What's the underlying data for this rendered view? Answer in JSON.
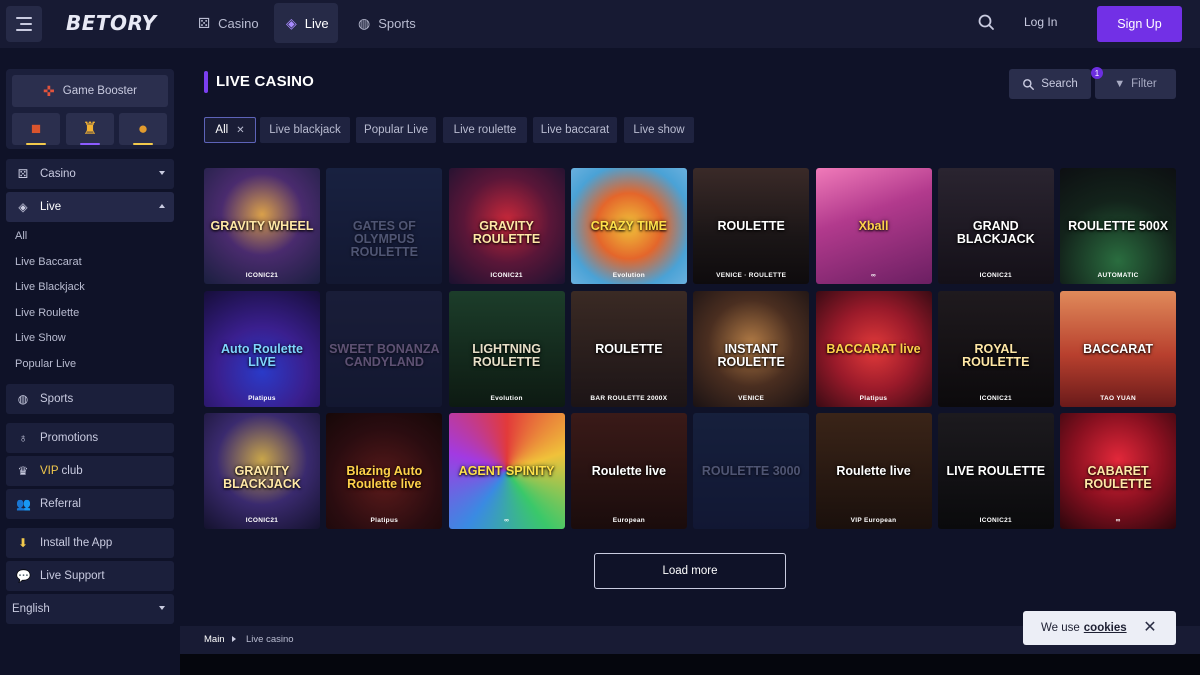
{
  "header": {
    "logo": "BETORY",
    "tabs": [
      {
        "label": "Casino",
        "icon": "casino-dice-icon"
      },
      {
        "label": "Live",
        "icon": "live-chip-icon"
      },
      {
        "label": "Sports",
        "icon": "sports-ball-icon"
      }
    ],
    "login_label": "Log In",
    "signup_label": "Sign Up",
    "accent_color": "#7230e6"
  },
  "sidebar": {
    "booster_label": "Game Booster",
    "booster_tiles": [
      {
        "icon": "dice-icon",
        "bar_color": "#f2c94c"
      },
      {
        "icon": "trophy-icon",
        "bar_color": "#8d5cff"
      },
      {
        "icon": "coin-icon",
        "bar_color": "#f2c94c"
      }
    ],
    "casino_label": "Casino",
    "live_label": "Live",
    "live_sub": [
      "All",
      "Live Baccarat",
      "Live Blackjack",
      "Live Roulette",
      "Live Show",
      "Popular Live"
    ],
    "sports_label": "Sports",
    "promotions_label": "Promotions",
    "vip_prefix": "VIP",
    "vip_suffix": "club",
    "referral_label": "Referral",
    "install_label": "Install the App",
    "support_label": "Live Support",
    "language": "English"
  },
  "main": {
    "title": "LIVE CASINO",
    "search_label": "Search",
    "filter_label": "Filter",
    "filter_count": "1",
    "chips": [
      "All",
      "Live blackjack",
      "Popular Live",
      "Live roulette",
      "Live baccarat",
      "Live show"
    ],
    "games": [
      {
        "name": "GRAVITY WHEEL",
        "provider": "ICONIC21"
      },
      {
        "name": "GATES OF OLYMPUS ROULETTE",
        "provider": ""
      },
      {
        "name": "GRAVITY ROULETTE",
        "provider": "ICONIC21"
      },
      {
        "name": "CRAZY TIME",
        "provider": "Evolution"
      },
      {
        "name": "ROULETTE",
        "provider": "VENICE · ROULETTE"
      },
      {
        "name": "Xball",
        "provider": "∞"
      },
      {
        "name": "GRAND BLACKJACK",
        "provider": "ICONIC21"
      },
      {
        "name": "ROULETTE 500X",
        "provider": "AUTOMATIC"
      },
      {
        "name": "Auto Roulette LIVE",
        "provider": "Platipus"
      },
      {
        "name": "SWEET BONANZA CANDYLAND",
        "provider": ""
      },
      {
        "name": "LIGHTNING ROULETTE",
        "provider": "Evolution"
      },
      {
        "name": "ROULETTE",
        "provider": "BAR ROULETTE 2000X"
      },
      {
        "name": "INSTANT ROULETTE",
        "provider": "VENICE"
      },
      {
        "name": "BACCARAT live",
        "provider": "Platipus"
      },
      {
        "name": "ROYAL ROULETTE",
        "provider": "ICONIC21"
      },
      {
        "name": "BACCARAT",
        "provider": "TAO YUAN"
      },
      {
        "name": "GRAVITY BLACKJACK",
        "provider": "ICONIC21"
      },
      {
        "name": "Blazing Auto Roulette live",
        "provider": "Platipus"
      },
      {
        "name": "AGENT SPINITY",
        "provider": "∞"
      },
      {
        "name": "Roulette live",
        "provider": "European"
      },
      {
        "name": "ROULETTE 3000",
        "provider": ""
      },
      {
        "name": "Roulette live",
        "provider": "VIP European"
      },
      {
        "name": "LIVE ROULETTE",
        "provider": "ICONIC21"
      },
      {
        "name": "CABARET ROULETTE",
        "provider": "∞"
      }
    ],
    "load_more_label": "Load more"
  },
  "breadcrumb": {
    "main": "Main",
    "current": "Live casino"
  },
  "cookie": {
    "prefix": "We use",
    "link": "cookies"
  }
}
